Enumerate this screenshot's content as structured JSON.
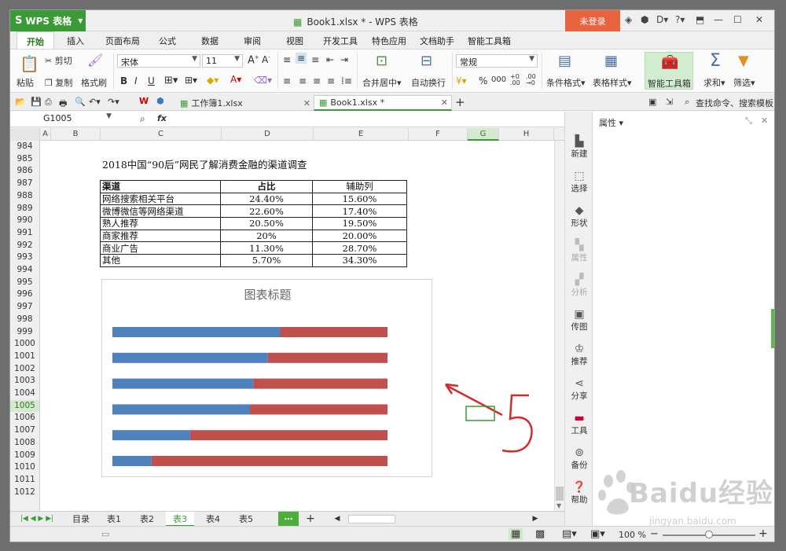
{
  "app": {
    "name": "WPS 表格",
    "title": "Book1.xlsx * - WPS 表格",
    "login_label": "未登录"
  },
  "menu": {
    "items": [
      "开始",
      "插入",
      "页面布局",
      "公式",
      "数据",
      "审阅",
      "视图",
      "开发工具",
      "特色应用",
      "文档助手",
      "智能工具箱"
    ]
  },
  "ribbon": {
    "paste": "粘贴",
    "cut": "剪切",
    "copy": "复制",
    "format_painter": "格式刷",
    "font_name": "宋体",
    "font_size": "11",
    "merge": "合并居中",
    "wrap": "自动换行",
    "number_format": "常规",
    "cond_format": "条件格式",
    "table_style": "表格样式",
    "smart_tools": "智能工具箱",
    "sum": "求和",
    "filter": "筛选",
    "percent": "%",
    "comma": "000"
  },
  "tabs": {
    "workbook1": "工作簿1.xlsx",
    "book1": "Book1.xlsx *",
    "search": "查找命令、搜索模板"
  },
  "formula": {
    "name_box": "G1005",
    "fx": "fx",
    "content": ""
  },
  "columns": [
    "A",
    "B",
    "C",
    "D",
    "E",
    "F",
    "G",
    "H"
  ],
  "rows": [
    "984",
    "985",
    "986",
    "987",
    "988",
    "989",
    "990",
    "991",
    "992",
    "993",
    "994",
    "995",
    "996",
    "997",
    "998",
    "999",
    "1000",
    "1001",
    "1002",
    "1003",
    "1004",
    "1005",
    "1006",
    "1007",
    "1008",
    "1009",
    "1010",
    "1011",
    "1012"
  ],
  "sheet": {
    "title": "2018中国“90后”网民了解消费金融的渠道调查",
    "headers": [
      "渠道",
      "占比",
      "辅助列"
    ],
    "table": [
      [
        "网络搜索相关平台",
        "24.40%",
        "15.60%"
      ],
      [
        "微博微信等网络渠道",
        "22.60%",
        "17.40%"
      ],
      [
        "熟人推荐",
        "20.50%",
        "19.50%"
      ],
      [
        "商家推荐",
        "20%",
        "20.00%"
      ],
      [
        "商业广告",
        "11.30%",
        "28.70%"
      ],
      [
        "其他",
        "5.70%",
        "34.30%"
      ]
    ]
  },
  "chart_data": {
    "type": "bar",
    "stacked": true,
    "orientation": "horizontal",
    "title": "图表标题",
    "categories": [
      "网络搜索相关平台",
      "微博微信等网络渠道",
      "熟人推荐",
      "商家推荐",
      "商业广告",
      "其他"
    ],
    "series": [
      {
        "name": "",
        "color": "#4f81bd",
        "values": [
          24.4,
          22.6,
          20.5,
          20.0,
          11.3,
          5.7
        ]
      },
      {
        "name": "",
        "color": "#c0504d",
        "values": [
          15.6,
          17.4,
          19.5,
          20.0,
          28.7,
          34.3
        ]
      }
    ],
    "xlim": [
      0,
      40
    ],
    "grid": false,
    "axes_visible": false
  },
  "annotation": {
    "handwritten_text": "5",
    "color": "#d62a2a"
  },
  "sheet_tabs": [
    "目录",
    "表1",
    "表2",
    "表3",
    "表4",
    "表5"
  ],
  "active_sheet": "表3",
  "sidebar": {
    "items": [
      "新建",
      "选择",
      "形状",
      "属性",
      "分析",
      "传图",
      "推荐",
      "分享",
      "工具",
      "备份",
      "帮助"
    ]
  },
  "panel": {
    "title": "属性"
  },
  "status": {
    "zoom": "100 %"
  },
  "watermark": {
    "brand": "Baidu经验",
    "url": "jingyan.baidu.com"
  }
}
